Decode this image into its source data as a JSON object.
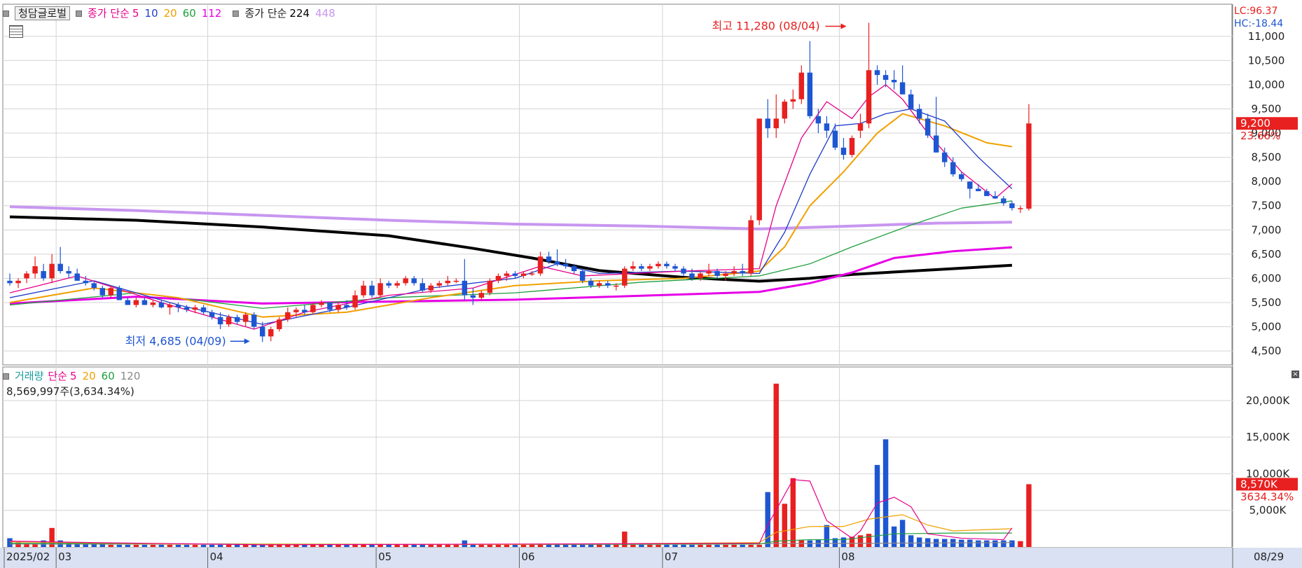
{
  "legend": {
    "stock_name": "청담글로벌",
    "price_ma_label": "종가 단순",
    "price_ma_periods": [
      {
        "label": "5",
        "color": "#e6008a"
      },
      {
        "label": "10",
        "color": "#1e3cc8"
      },
      {
        "label": "20",
        "color": "#f0a000"
      },
      {
        "label": "60",
        "color": "#1e9e3c"
      },
      {
        "label": "112",
        "color": "#e600e6"
      }
    ],
    "long_ma_label": "종가 단순",
    "long_ma_periods": [
      {
        "label": "224",
        "color": "#000000"
      },
      {
        "label": "448",
        "color": "#c896f0"
      }
    ],
    "volume_label": "거래량",
    "volume_ma_label": "단순",
    "volume_ma_periods": [
      {
        "label": "5",
        "color": "#e6008a"
      },
      {
        "label": "20",
        "color": "#f0a000"
      },
      {
        "label": "60",
        "color": "#1e9e3c"
      },
      {
        "label": "120",
        "color": "#888888"
      }
    ]
  },
  "volume_info": "8,569,997주(3,634.34%)",
  "lc_text": "LC:96.37",
  "hc_text": "HC:-18.44",
  "colors": {
    "up": "#e82020",
    "down": "#1e56d2",
    "grid": "#d4d4d4",
    "axis_bg": "#d9e1f2"
  },
  "chart_data": {
    "type": "candlestick",
    "title": "청담글로벌",
    "x_tick_labels": [
      "2025/02",
      "03",
      "04",
      "05",
      "06",
      "07",
      "08"
    ],
    "x_tick_index": [
      0,
      6,
      24,
      44,
      61,
      78,
      99
    ],
    "last_date_label": "08/29",
    "price_axis": {
      "ylim": [
        4400,
        11200
      ],
      "ticks": [
        4500,
        5000,
        5500,
        6000,
        6500,
        7000,
        7500,
        8000,
        8500,
        9000,
        9500,
        10000,
        10500,
        11000
      ],
      "tick_labels": [
        "4,500",
        "5,000",
        "5,500",
        "6,000",
        "6,500",
        "7,000",
        "7,500",
        "8,000",
        "8,500",
        "9,000",
        "9,500",
        "10,000",
        "10,500",
        "11,000"
      ]
    },
    "volume_axis": {
      "ylim": [
        0,
        24000
      ],
      "ticks": [
        5000,
        10000,
        15000,
        20000
      ],
      "tick_labels": [
        "5,000K",
        "10,000K",
        "15,000K",
        "20,000K"
      ]
    },
    "current_price": {
      "value": 9200,
      "label": "9,200",
      "change": "23.66%"
    },
    "current_volume": {
      "value": 8570,
      "label": "8,570K",
      "ratio": "3634.34%"
    },
    "high_annotation": {
      "text": "최고 11,280 (08/04)",
      "value": 11280,
      "index": 100
    },
    "low_annotation": {
      "text": "최저 4,685 (04/09)",
      "value": 4685,
      "index": 29
    },
    "ohlc": [
      [
        5950,
        6100,
        5850,
        5900
      ],
      [
        5900,
        6000,
        5800,
        5950
      ],
      [
        6000,
        6150,
        5900,
        6100
      ],
      [
        6100,
        6450,
        6000,
        6250
      ],
      [
        6150,
        6300,
        5950,
        6000
      ],
      [
        6000,
        6500,
        5900,
        6300
      ],
      [
        6300,
        6650,
        6100,
        6150
      ],
      [
        6150,
        6250,
        6000,
        6100
      ],
      [
        6100,
        6200,
        5950,
        5950
      ],
      [
        5950,
        6050,
        5850,
        5900
      ],
      [
        5900,
        5950,
        5750,
        5800
      ],
      [
        5800,
        5850,
        5600,
        5650
      ],
      [
        5650,
        5850,
        5600,
        5800
      ],
      [
        5800,
        5850,
        5550,
        5550
      ],
      [
        5550,
        5600,
        5450,
        5450
      ],
      [
        5450,
        5600,
        5400,
        5550
      ],
      [
        5550,
        5600,
        5450,
        5450
      ],
      [
        5450,
        5550,
        5400,
        5500
      ],
      [
        5500,
        5550,
        5380,
        5400
      ],
      [
        5400,
        5500,
        5250,
        5450
      ],
      [
        5450,
        5500,
        5300,
        5400
      ],
      [
        5400,
        5450,
        5300,
        5350
      ],
      [
        5350,
        5450,
        5280,
        5400
      ],
      [
        5400,
        5450,
        5250,
        5300
      ],
      [
        5300,
        5350,
        5150,
        5200
      ],
      [
        5200,
        5300,
        4950,
        5050
      ],
      [
        5050,
        5250,
        5000,
        5200
      ],
      [
        5200,
        5250,
        5050,
        5100
      ],
      [
        5100,
        5300,
        5000,
        5250
      ],
      [
        5250,
        5300,
        4950,
        5000
      ],
      [
        5000,
        5100,
        4685,
        4800
      ],
      [
        4800,
        5000,
        4700,
        4950
      ],
      [
        4950,
        5200,
        4900,
        5150
      ],
      [
        5150,
        5400,
        5100,
        5300
      ],
      [
        5300,
        5400,
        5200,
        5350
      ],
      [
        5350,
        5450,
        5250,
        5300
      ],
      [
        5300,
        5500,
        5250,
        5450
      ],
      [
        5450,
        5550,
        5400,
        5500
      ],
      [
        5500,
        5500,
        5300,
        5350
      ],
      [
        5350,
        5500,
        5300,
        5450
      ],
      [
        5450,
        5550,
        5350,
        5400
      ],
      [
        5400,
        5750,
        5350,
        5650
      ],
      [
        5650,
        5950,
        5600,
        5850
      ],
      [
        5850,
        5950,
        5600,
        5650
      ],
      [
        5650,
        6000,
        5600,
        5900
      ],
      [
        5900,
        5950,
        5800,
        5850
      ],
      [
        5850,
        5950,
        5800,
        5900
      ],
      [
        5900,
        6050,
        5850,
        6000
      ],
      [
        6000,
        6050,
        5850,
        5900
      ],
      [
        5900,
        6000,
        5700,
        5750
      ],
      [
        5750,
        5900,
        5700,
        5850
      ],
      [
        5850,
        5950,
        5800,
        5900
      ],
      [
        5900,
        6050,
        5850,
        5950
      ],
      [
        5950,
        6000,
        5900,
        5950
      ],
      [
        5950,
        6400,
        5550,
        5650
      ],
      [
        5650,
        5800,
        5450,
        5600
      ],
      [
        5600,
        5750,
        5550,
        5700
      ],
      [
        5700,
        6000,
        5650,
        5950
      ],
      [
        5950,
        6100,
        5900,
        6050
      ],
      [
        6050,
        6150,
        5950,
        6100
      ],
      [
        6100,
        6150,
        6000,
        6050
      ],
      [
        6050,
        6150,
        6000,
        6100
      ],
      [
        6100,
        6150,
        6050,
        6100
      ],
      [
        6100,
        6550,
        6050,
        6450
      ],
      [
        6450,
        6550,
        6300,
        6350
      ],
      [
        6350,
        6600,
        6250,
        6300
      ],
      [
        6300,
        6400,
        6200,
        6250
      ],
      [
        6250,
        6300,
        6100,
        6150
      ],
      [
        6150,
        6200,
        5900,
        5950
      ],
      [
        5950,
        6000,
        5800,
        5850
      ],
      [
        5850,
        5950,
        5800,
        5900
      ],
      [
        5900,
        5950,
        5800,
        5850
      ],
      [
        5850,
        5900,
        5750,
        5850
      ],
      [
        5850,
        6250,
        5800,
        6200
      ],
      [
        6200,
        6350,
        6150,
        6250
      ],
      [
        6250,
        6300,
        6150,
        6200
      ],
      [
        6200,
        6300,
        6150,
        6250
      ],
      [
        6250,
        6350,
        6200,
        6300
      ],
      [
        6300,
        6350,
        6200,
        6250
      ],
      [
        6250,
        6300,
        6150,
        6200
      ],
      [
        6200,
        6250,
        6050,
        6100
      ],
      [
        6100,
        6200,
        5950,
        6000
      ],
      [
        6000,
        6150,
        5950,
        6100
      ],
      [
        6100,
        6300,
        6050,
        6150
      ],
      [
        6150,
        6200,
        6000,
        6050
      ],
      [
        6050,
        6150,
        5950,
        6100
      ],
      [
        6100,
        6250,
        6050,
        6150
      ],
      [
        6150,
        6300,
        6050,
        6100
      ],
      [
        6100,
        7300,
        6050,
        7200
      ],
      [
        7200,
        9300,
        7100,
        9300
      ],
      [
        9300,
        9700,
        8900,
        9100
      ],
      [
        9100,
        9800,
        8900,
        9300
      ],
      [
        9300,
        9700,
        9200,
        9650
      ],
      [
        9650,
        9900,
        9500,
        9700
      ],
      [
        9700,
        10400,
        9600,
        10250
      ],
      [
        10250,
        10900,
        9300,
        9350
      ],
      [
        9350,
        9500,
        9000,
        9200
      ],
      [
        9200,
        9350,
        8900,
        9050
      ],
      [
        9050,
        9200,
        8650,
        8700
      ],
      [
        8700,
        8900,
        8450,
        8550
      ],
      [
        8550,
        8950,
        8500,
        8900
      ],
      [
        9050,
        9400,
        8900,
        9200
      ],
      [
        9200,
        11280,
        9100,
        10300
      ],
      [
        10300,
        10400,
        10000,
        10200
      ],
      [
        10200,
        10300,
        9950,
        10100
      ],
      [
        10100,
        10300,
        9900,
        10050
      ],
      [
        10050,
        10400,
        9900,
        9800
      ],
      [
        9800,
        9900,
        9600,
        9500
      ],
      [
        9500,
        9600,
        9200,
        9300
      ],
      [
        9300,
        9400,
        8900,
        8950
      ],
      [
        8950,
        9750,
        8600,
        8600
      ],
      [
        8600,
        8700,
        8300,
        8400
      ],
      [
        8400,
        8500,
        8100,
        8150
      ],
      [
        8150,
        8200,
        8000,
        8050
      ],
      [
        8000,
        8000,
        7650,
        7850
      ],
      [
        7850,
        7950,
        7800,
        7800
      ],
      [
        7800,
        7850,
        7700,
        7700
      ],
      [
        7700,
        7800,
        7650,
        7650
      ],
      [
        7650,
        7700,
        7500,
        7550
      ],
      [
        7550,
        7600,
        7400,
        7450
      ],
      [
        7450,
        7500,
        7350,
        7450
      ],
      [
        7440,
        9600,
        7400,
        9200
      ]
    ],
    "volume": [
      1200,
      600,
      500,
      500,
      900,
      2600,
      900,
      700,
      500,
      400,
      400,
      400,
      300,
      300,
      300,
      300,
      300,
      300,
      300,
      300,
      300,
      300,
      300,
      300,
      300,
      300,
      300,
      300,
      300,
      300,
      300,
      300,
      300,
      300,
      300,
      300,
      300,
      400,
      300,
      300,
      300,
      300,
      300,
      300,
      300,
      300,
      300,
      300,
      300,
      300,
      300,
      300,
      300,
      300,
      900,
      400,
      300,
      400,
      300,
      300,
      300,
      300,
      300,
      300,
      300,
      300,
      300,
      300,
      300,
      300,
      300,
      300,
      300,
      2100,
      300,
      300,
      300,
      300,
      300,
      300,
      300,
      300,
      300,
      300,
      300,
      300,
      300,
      300,
      300,
      300,
      7500,
      22300,
      5900,
      9400,
      1000,
      900,
      1000,
      3000,
      1200,
      1300,
      1400,
      1600,
      1800,
      11200,
      14700,
      2800,
      3700,
      1600,
      1300,
      1200,
      1100,
      1100,
      1100,
      1000,
      1000,
      900,
      900,
      900,
      900,
      900,
      800,
      8570
    ],
    "ma_224": [
      [
        0,
        7270
      ],
      [
        15,
        7200
      ],
      [
        30,
        7060
      ],
      [
        45,
        6880
      ],
      [
        55,
        6620
      ],
      [
        62,
        6420
      ],
      [
        70,
        6160
      ],
      [
        80,
        6020
      ],
      [
        89,
        5940
      ],
      [
        95,
        6000
      ],
      [
        100,
        6080
      ],
      [
        110,
        6180
      ],
      [
        119,
        6270
      ]
    ],
    "ma_448": [
      [
        0,
        7480
      ],
      [
        15,
        7400
      ],
      [
        30,
        7300
      ],
      [
        45,
        7200
      ],
      [
        60,
        7120
      ],
      [
        75,
        7080
      ],
      [
        89,
        7020
      ],
      [
        100,
        7080
      ],
      [
        110,
        7140
      ],
      [
        119,
        7160
      ]
    ],
    "ma_112": [
      [
        0,
        5480
      ],
      [
        15,
        5620
      ],
      [
        30,
        5480
      ],
      [
        45,
        5520
      ],
      [
        60,
        5560
      ],
      [
        75,
        5640
      ],
      [
        89,
        5720
      ],
      [
        95,
        5900
      ],
      [
        100,
        6120
      ],
      [
        105,
        6420
      ],
      [
        112,
        6560
      ],
      [
        119,
        6640
      ]
    ],
    "ma_60": [
      [
        0,
        5450
      ],
      [
        15,
        5700
      ],
      [
        30,
        5380
      ],
      [
        45,
        5600
      ],
      [
        60,
        5700
      ],
      [
        75,
        5920
      ],
      [
        89,
        6050
      ],
      [
        95,
        6300
      ],
      [
        100,
        6650
      ],
      [
        107,
        7100
      ],
      [
        113,
        7450
      ],
      [
        119,
        7600
      ]
    ],
    "ma_20": [
      [
        0,
        5500
      ],
      [
        10,
        5800
      ],
      [
        20,
        5600
      ],
      [
        30,
        5200
      ],
      [
        40,
        5300
      ],
      [
        50,
        5600
      ],
      [
        60,
        5850
      ],
      [
        70,
        5950
      ],
      [
        80,
        6000
      ],
      [
        89,
        6150
      ],
      [
        92,
        6650
      ],
      [
        95,
        7500
      ],
      [
        99,
        8200
      ],
      [
        103,
        9000
      ],
      [
        106,
        9400
      ],
      [
        111,
        9150
      ],
      [
        116,
        8800
      ],
      [
        119,
        8720
      ]
    ],
    "ma_10": [
      [
        0,
        5600
      ],
      [
        10,
        5950
      ],
      [
        20,
        5450
      ],
      [
        30,
        5050
      ],
      [
        40,
        5400
      ],
      [
        50,
        5800
      ],
      [
        60,
        6000
      ],
      [
        65,
        6300
      ],
      [
        70,
        6100
      ],
      [
        80,
        6150
      ],
      [
        89,
        6100
      ],
      [
        92,
        6950
      ],
      [
        95,
        8150
      ],
      [
        98,
        9150
      ],
      [
        101,
        9200
      ],
      [
        104,
        9400
      ],
      [
        107,
        9500
      ],
      [
        111,
        9250
      ],
      [
        115,
        8500
      ],
      [
        119,
        7850
      ]
    ],
    "ma_5": [
      [
        0,
        5700
      ],
      [
        8,
        6050
      ],
      [
        18,
        5500
      ],
      [
        29,
        4950
      ],
      [
        35,
        5300
      ],
      [
        45,
        5650
      ],
      [
        55,
        5800
      ],
      [
        63,
        6250
      ],
      [
        68,
        6050
      ],
      [
        80,
        6150
      ],
      [
        89,
        6200
      ],
      [
        91,
        7500
      ],
      [
        94,
        8900
      ],
      [
        97,
        9650
      ],
      [
        100,
        9300
      ],
      [
        102,
        9750
      ],
      [
        104,
        10000
      ],
      [
        106,
        9700
      ],
      [
        109,
        9000
      ],
      [
        113,
        8200
      ],
      [
        117,
        7650
      ],
      [
        119,
        7950
      ]
    ],
    "vol_ma_5": [
      [
        0,
        800
      ],
      [
        10,
        600
      ],
      [
        30,
        300
      ],
      [
        60,
        400
      ],
      [
        89,
        500
      ],
      [
        90,
        3000
      ],
      [
        93,
        9200
      ],
      [
        95,
        9000
      ],
      [
        97,
        3600
      ],
      [
        100,
        1200
      ],
      [
        101,
        2200
      ],
      [
        103,
        6000
      ],
      [
        105,
        6800
      ],
      [
        107,
        5500
      ],
      [
        109,
        1800
      ],
      [
        113,
        1200
      ],
      [
        118,
        1000
      ],
      [
        119,
        2600
      ]
    ],
    "vol_ma_20": [
      [
        0,
        700
      ],
      [
        20,
        400
      ],
      [
        60,
        350
      ],
      [
        89,
        600
      ],
      [
        91,
        2000
      ],
      [
        95,
        2800
      ],
      [
        99,
        2800
      ],
      [
        102,
        3800
      ],
      [
        106,
        4400
      ],
      [
        109,
        3000
      ],
      [
        112,
        2200
      ],
      [
        119,
        2500
      ]
    ],
    "vol_ma_60": [
      [
        0,
        500
      ],
      [
        30,
        400
      ],
      [
        60,
        350
      ],
      [
        89,
        400
      ],
      [
        91,
        800
      ],
      [
        95,
        1000
      ],
      [
        99,
        1000
      ],
      [
        105,
        1800
      ],
      [
        112,
        1900
      ],
      [
        119,
        1900
      ]
    ],
    "vol_ma_120": [
      [
        0,
        400
      ],
      [
        60,
        350
      ],
      [
        100,
        500
      ],
      [
        119,
        600
      ]
    ]
  }
}
